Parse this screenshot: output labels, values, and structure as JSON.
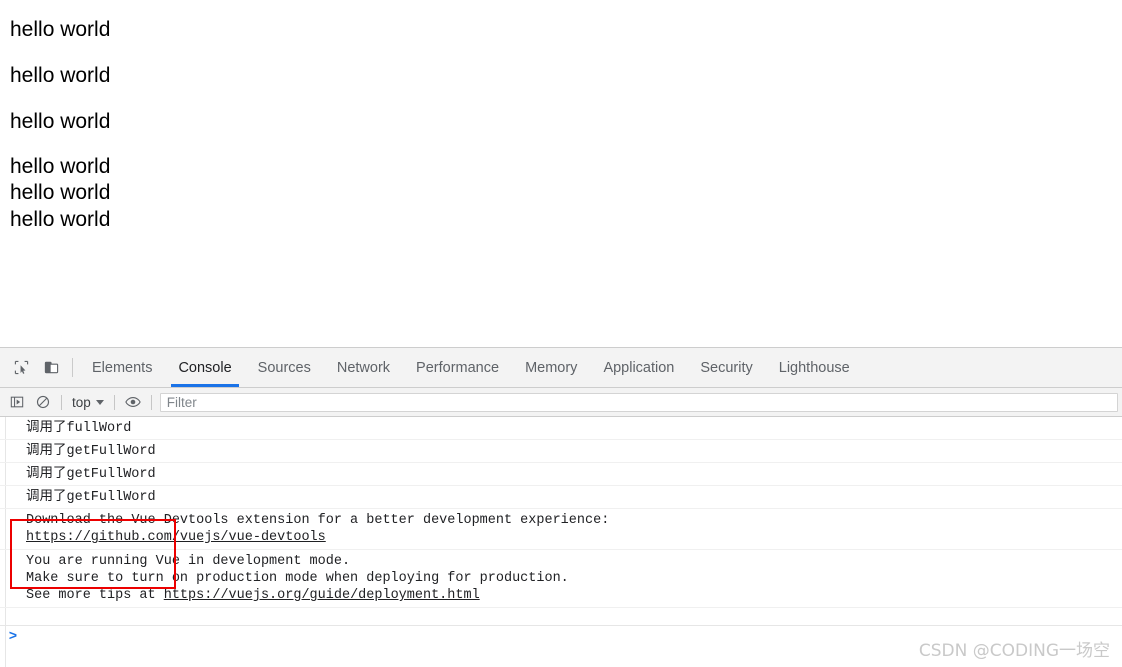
{
  "page": {
    "lines": [
      {
        "text": "hello world",
        "style": "paragraph"
      },
      {
        "text": "hello world",
        "style": "paragraph"
      },
      {
        "text": "hello world",
        "style": "paragraph"
      },
      {
        "text": "hello world",
        "style": "compact"
      },
      {
        "text": "hello world",
        "style": "compact"
      },
      {
        "text": "hello world",
        "style": "compact"
      }
    ]
  },
  "devtools": {
    "icons": {
      "inspect": "inspect-element-icon",
      "device": "device-toolbar-icon"
    },
    "tabs": [
      {
        "label": "Elements",
        "active": false
      },
      {
        "label": "Console",
        "active": true
      },
      {
        "label": "Sources",
        "active": false
      },
      {
        "label": "Network",
        "active": false
      },
      {
        "label": "Performance",
        "active": false
      },
      {
        "label": "Memory",
        "active": false
      },
      {
        "label": "Application",
        "active": false
      },
      {
        "label": "Security",
        "active": false
      },
      {
        "label": "Lighthouse",
        "active": false
      }
    ],
    "active_tab": "Console",
    "accent_color": "#1a73e8",
    "toolbar": {
      "sidebar_toggle": "console-sidebar-icon",
      "clear_console": "clear-console-icon",
      "context_label": "top",
      "context_caret": "chevron-down-icon",
      "live_expression": "eye-icon",
      "filter_placeholder": "Filter",
      "filter_value": ""
    },
    "console": {
      "messages": [
        {
          "id": "msg-fullword",
          "lines": [
            "调用了fullWord"
          ],
          "cjk_prefix": "调用了",
          "code": "fullWord",
          "highlighted": false
        },
        {
          "id": "msg-getfullword-1",
          "lines": [
            "调用了getFullWord"
          ],
          "cjk_prefix": "调用了",
          "code": "getFullWord",
          "highlighted": true
        },
        {
          "id": "msg-getfullword-2",
          "lines": [
            "调用了getFullWord"
          ],
          "cjk_prefix": "调用了",
          "code": "getFullWord",
          "highlighted": true
        },
        {
          "id": "msg-getfullword-3",
          "lines": [
            "调用了getFullWord"
          ],
          "cjk_prefix": "调用了",
          "code": "getFullWord",
          "highlighted": true
        }
      ],
      "vue_devtools_message": {
        "line1": "Download the Vue Devtools extension for a better development experience:",
        "link": "https://github.com/vuejs/vue-devtools"
      },
      "vue_mode_message": {
        "line1": "You are running Vue in development mode.",
        "line2": "Make sure to turn on production mode when deploying for production.",
        "line3_prefix": "See more tips at ",
        "line3_link": "https://vuejs.org/guide/deployment.html"
      },
      "prompt_symbol": ">",
      "prompt_value": "",
      "annotation_box_color": "#ec0000"
    }
  },
  "watermark": {
    "text": "CSDN @CODING一场空"
  }
}
